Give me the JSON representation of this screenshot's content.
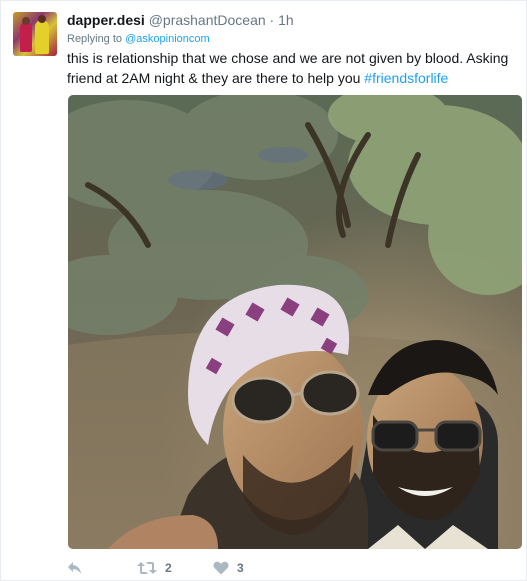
{
  "tweet": {
    "fullname": "dapper.desi",
    "username": "@prashantDocean",
    "separator": "·",
    "time": "1h",
    "replying_prefix": "Replying to",
    "replying_handle": "@askopinioncom",
    "text": "this is relationship that we chose and we are not given by blood. Asking friend at 2AM night & they are  there to help you",
    "hashtag": "#friendsforlife"
  },
  "media": {
    "photo_icon": "selfie-photo"
  },
  "actions": {
    "reply_icon": "reply-icon",
    "retweet_icon": "retweet-icon",
    "retweet_count": "2",
    "like_icon": "heart-icon",
    "like_count": "3"
  },
  "colors": {
    "link": "#1da1f2",
    "secondary": "#657786",
    "text": "#14171a",
    "border": "#e6ecf0"
  }
}
